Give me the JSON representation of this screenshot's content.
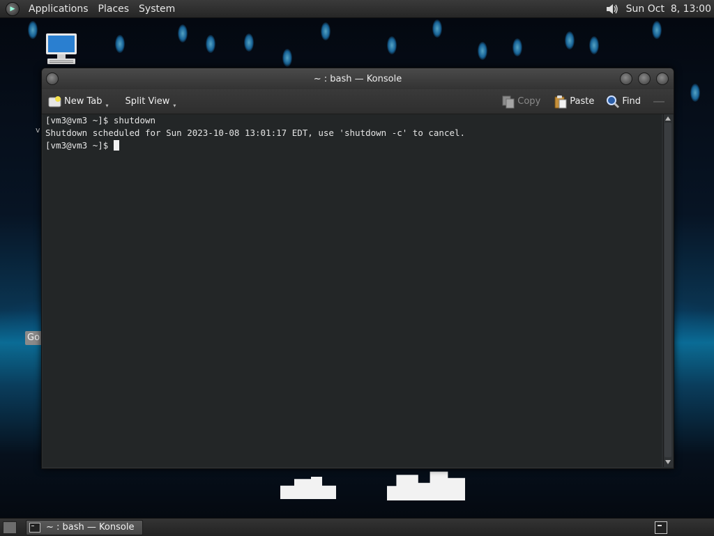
{
  "top_panel": {
    "menus": [
      "Applications",
      "Places",
      "System"
    ],
    "clock": "Sun Oct  8, 13:00"
  },
  "desktop": {
    "partial_button_label": "Go",
    "partial_icon_label": "v"
  },
  "window": {
    "title": "~ : bash — Konsole",
    "toolbar": {
      "new_tab": "New Tab",
      "split_view": "Split View",
      "copy": "Copy",
      "paste": "Paste",
      "find": "Find"
    }
  },
  "terminal": {
    "lines": [
      "[vm3@vm3 ~]$ shutdown",
      "Shutdown scheduled for Sun 2023-10-08 13:01:17 EDT, use 'shutdown -c' to cancel.",
      "[vm3@vm3 ~]$ "
    ]
  },
  "taskbar": {
    "task_label": "~ : bash — Konsole"
  },
  "icons": {
    "menu_logo": "distribution-logo-icon",
    "volume": "speaker-volume-icon",
    "computer": "computer-icon",
    "new_tab": "new-tab-icon",
    "copy": "copy-icon",
    "paste": "clipboard-paste-icon",
    "find": "magnifier-icon",
    "terminal": "terminal-icon",
    "show_desktop": "show-desktop-icon"
  },
  "colors": {
    "terminal_bg": "#232627",
    "terminal_fg": "#e5e5e5",
    "panel_bg": "#2c2c2c",
    "desktop_glow": "#0b6c94"
  }
}
